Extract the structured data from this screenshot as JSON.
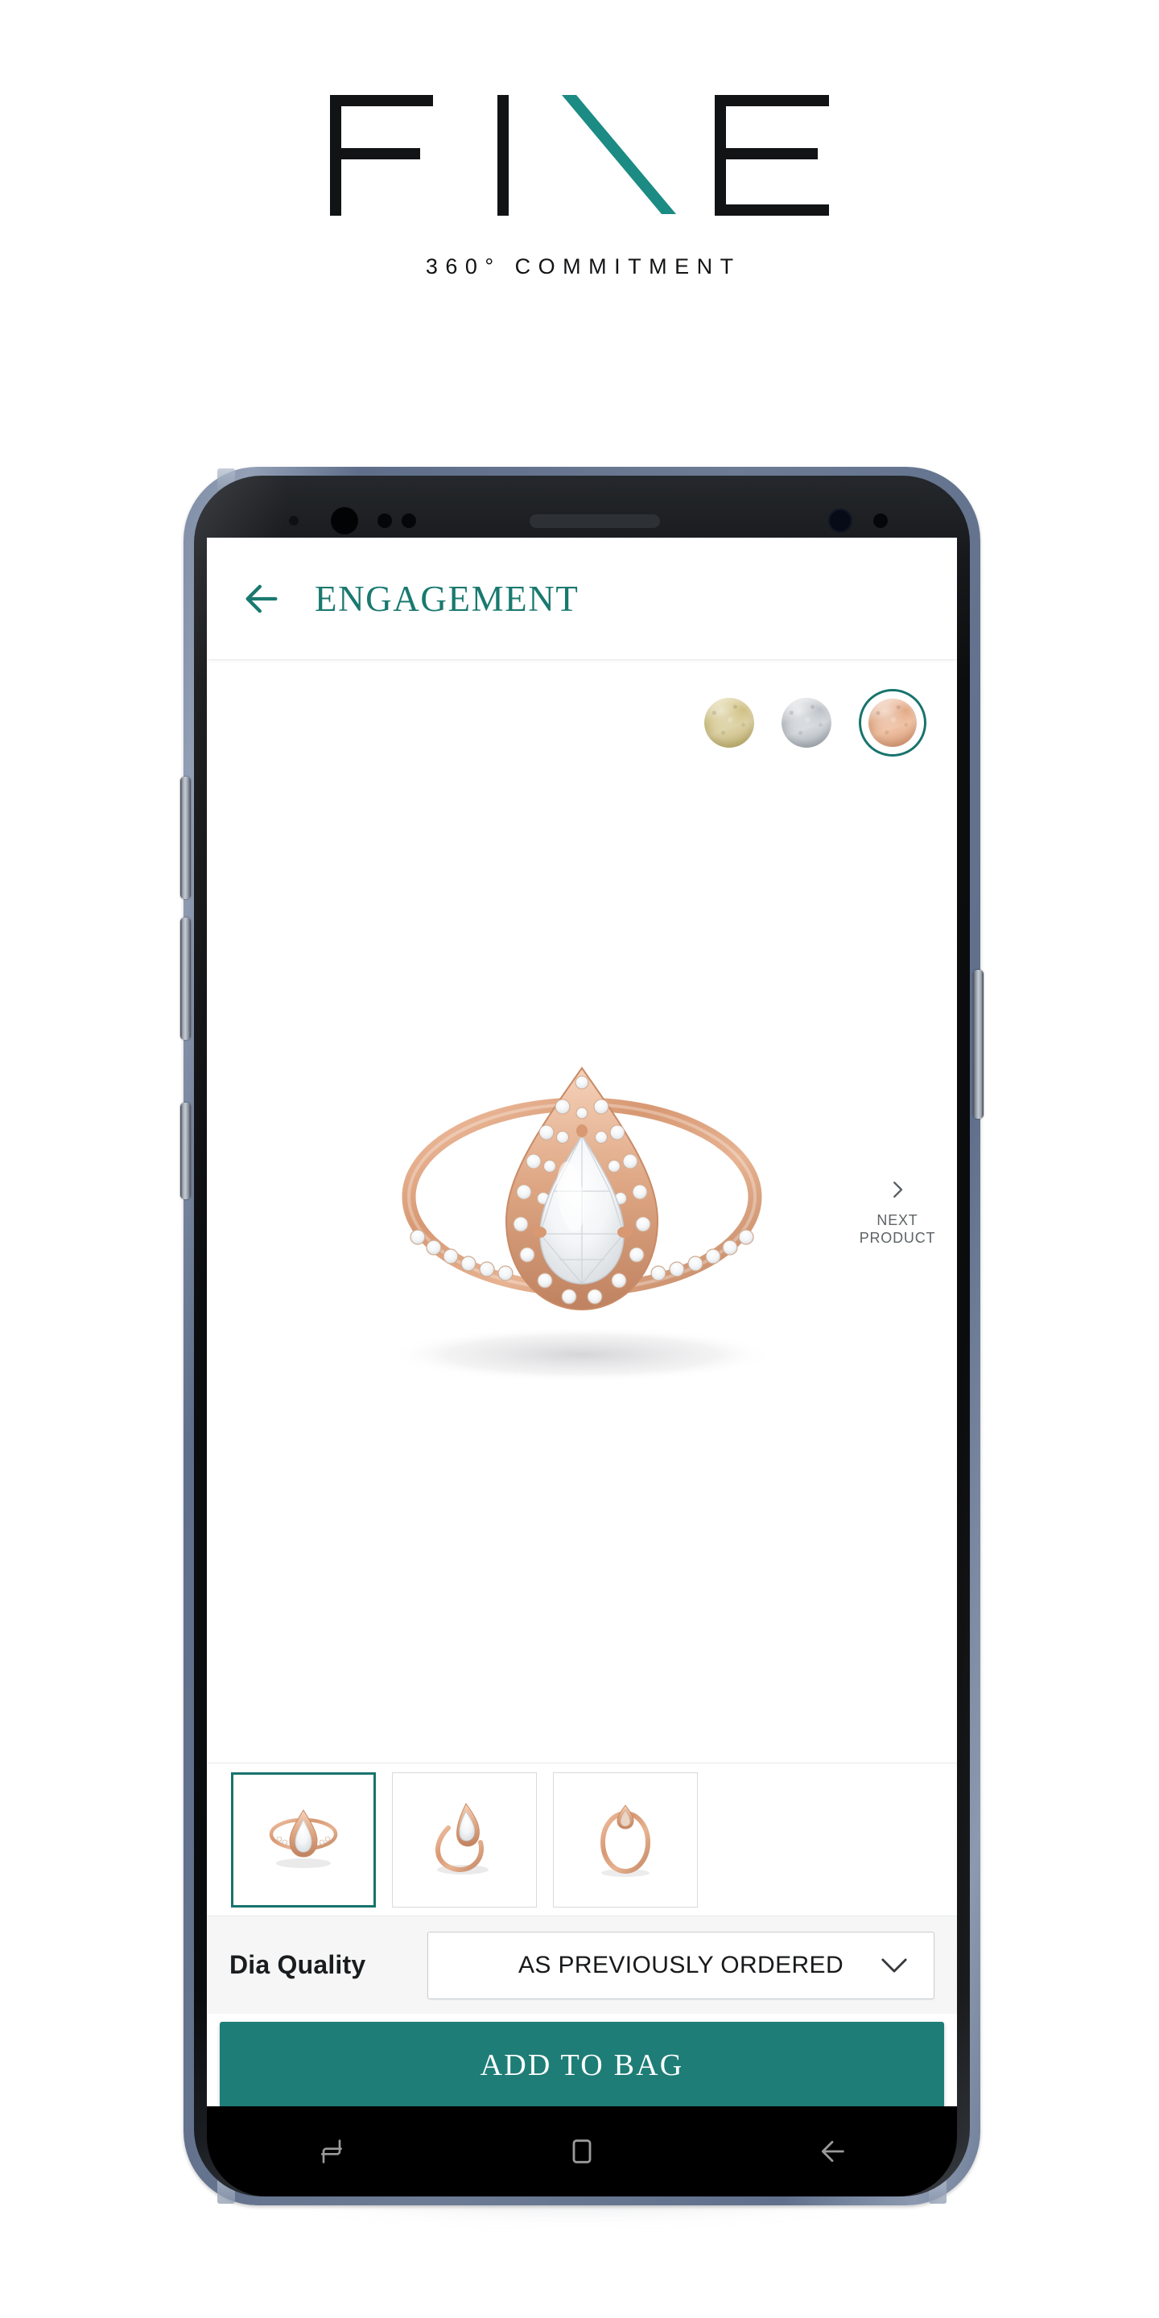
{
  "brand": {
    "logo_text": "FINE",
    "logo_accent_color": "#1b8b83",
    "logo_letters": [
      "F",
      "I",
      "N",
      "E"
    ],
    "tagline": "360° COMMITMENT"
  },
  "app": {
    "header": {
      "back_icon": "arrow-left-icon",
      "title": "ENGAGEMENT",
      "title_color": "#19796f"
    },
    "metal_swatches": {
      "name": "metal-color-selector",
      "options": [
        {
          "id": "yellow-gold",
          "label": "Yellow Gold",
          "color": "#cfc082",
          "selected": false
        },
        {
          "id": "white-gold",
          "label": "White Gold",
          "color": "#bcc1c7",
          "selected": false
        },
        {
          "id": "rose-gold",
          "label": "Rose Gold",
          "color": "#e2a985",
          "selected": true
        }
      ],
      "selection_ring_color": "#17746c"
    },
    "product": {
      "image_alt": "Pear cut halo diamond engagement ring in rose gold",
      "metal_tone": "#d79a76"
    },
    "next_product": {
      "icon": "chevron-right-icon",
      "line1": "NEXT",
      "line2": "PRODUCT"
    },
    "thumbnails": [
      {
        "id": "thumb-1",
        "alt": "Ring front view",
        "selected": true
      },
      {
        "id": "thumb-2",
        "alt": "Ring angled view",
        "selected": false
      },
      {
        "id": "thumb-3",
        "alt": "Ring top view",
        "selected": false
      }
    ],
    "quality": {
      "label": "Dia Quality",
      "selected_value": "AS PREVIOUSLY ORDERED",
      "chevron_icon": "chevron-down-icon"
    },
    "cta": {
      "label": "ADD TO BAG",
      "color": "#1e7d77"
    },
    "navbar": {
      "recents_icon": "recents-icon",
      "home_icon": "home-square-icon",
      "back_icon": "back-arrow-icon"
    }
  }
}
